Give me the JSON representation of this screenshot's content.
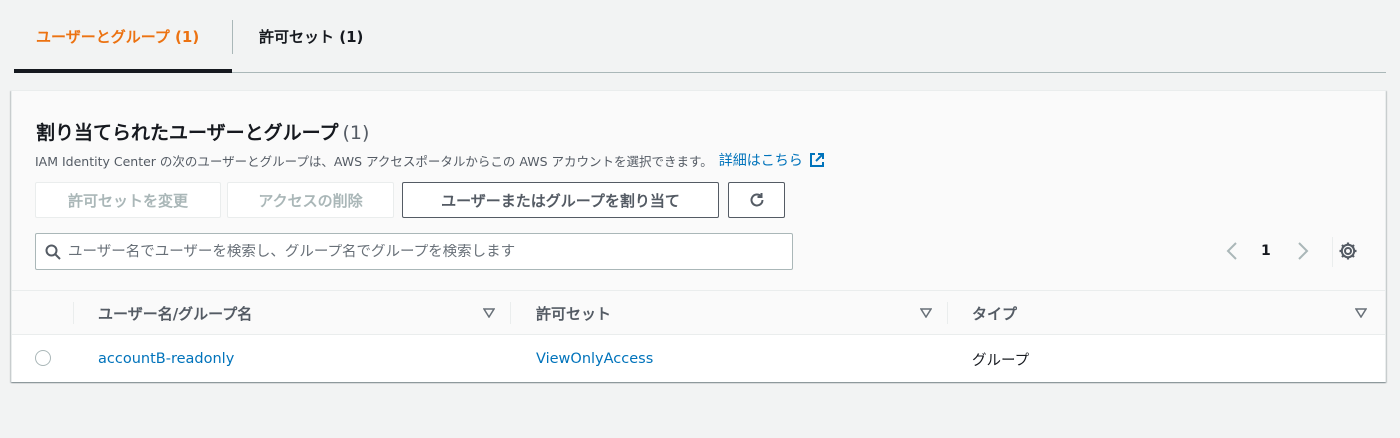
{
  "tabs": [
    {
      "label": "ユーザーとグループ (1)",
      "active": true
    },
    {
      "label": "許可セット (1)",
      "active": false
    }
  ],
  "panel": {
    "title": "割り当てられたユーザーとグループ",
    "count": "(1)",
    "description": "IAM Identity Center の次のユーザーとグループは、AWS アクセスポータルからこの AWS アカウントを選択できます。",
    "learn_more": "詳細はこちら"
  },
  "actions": {
    "change_permission": "許可セットを変更",
    "remove_access": "アクセスの削除",
    "assign": "ユーザーまたはグループを割り当て"
  },
  "search": {
    "placeholder": "ユーザー名でユーザーを検索し、グループ名でグループを検索します",
    "value": ""
  },
  "pagination": {
    "current_page": "1"
  },
  "table": {
    "columns": [
      "ユーザー名/グループ名",
      "許可セット",
      "タイプ"
    ],
    "rows": [
      {
        "name": "accountB-readonly",
        "permission_set": "ViewOnlyAccess",
        "type": "グループ"
      }
    ]
  },
  "colors": {
    "accent": "#ec7211",
    "link": "#0073bb",
    "text": "#16191f",
    "muted": "#545b64"
  }
}
